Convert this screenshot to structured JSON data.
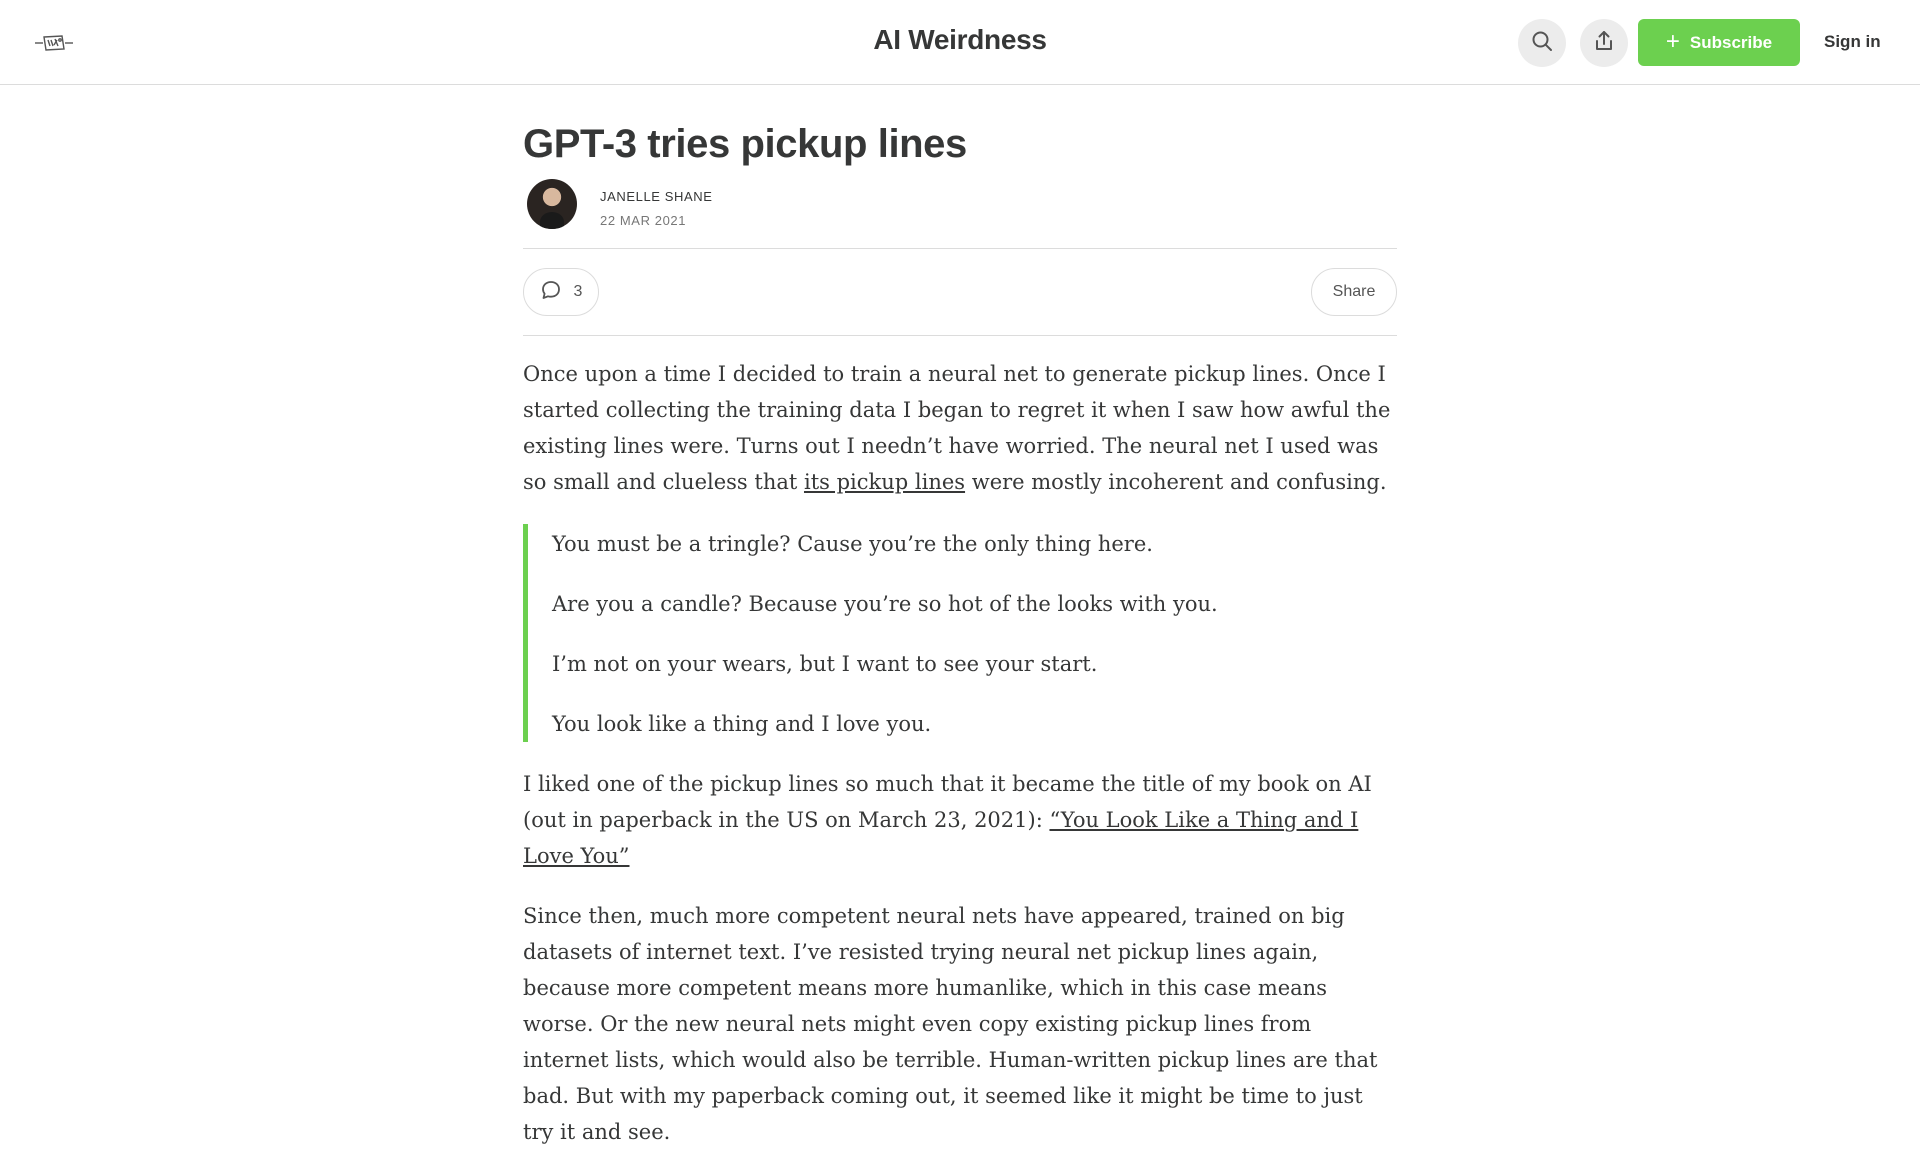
{
  "header": {
    "publication_title": "AI Weirdness",
    "subscribe_label": "Subscribe",
    "signin_label": "Sign in"
  },
  "post": {
    "title": "GPT-3 tries pickup lines",
    "author": "JANELLE SHANE",
    "date": "22 MAR 2021",
    "comment_count": "3",
    "share_label": "Share",
    "para1_before": "Once upon a time I decided to train a neural net to generate pickup lines. Once I started collecting the training data I began to regret it when I saw how awful the existing lines were. Turns out I needn’t have worried. The neural net I used was so small and clueless that ",
    "para1_link": "its pickup lines",
    "para1_after": " were mostly incoherent and confusing.",
    "quotes": [
      "You must be a tringle? Cause you’re the only thing here.",
      "Are you a candle? Because you’re so hot of the looks with you.",
      "I’m not on your wears, but I want to see your start.",
      "You look like a thing and I love you."
    ],
    "para2_before": "I liked one of the pickup lines so much that it became the title of my book on AI (out in paperback in the US on March 23, 2021): ",
    "para2_link": "“You Look Like a Thing and I Love You”",
    "para3": "Since then, much more competent neural nets have appeared, trained on big datasets of internet text. I’ve resisted trying neural net pickup lines again, because more competent means more humanlike, which in this case means worse. Or the new neural nets might even copy existing pickup lines from internet lists, which would also be terrible. Human-written pickup lines are that bad. But with my paperback coming out, it seemed like it might be time to just try it and see."
  },
  "icons": {
    "logo": "doodle-logo-icon",
    "search": "search-icon",
    "share_top": "share-upload-icon",
    "comment": "comment-bubble-icon"
  },
  "colors": {
    "accent": "#6cd04f",
    "text": "#363737",
    "border": "#dcdcdc"
  }
}
